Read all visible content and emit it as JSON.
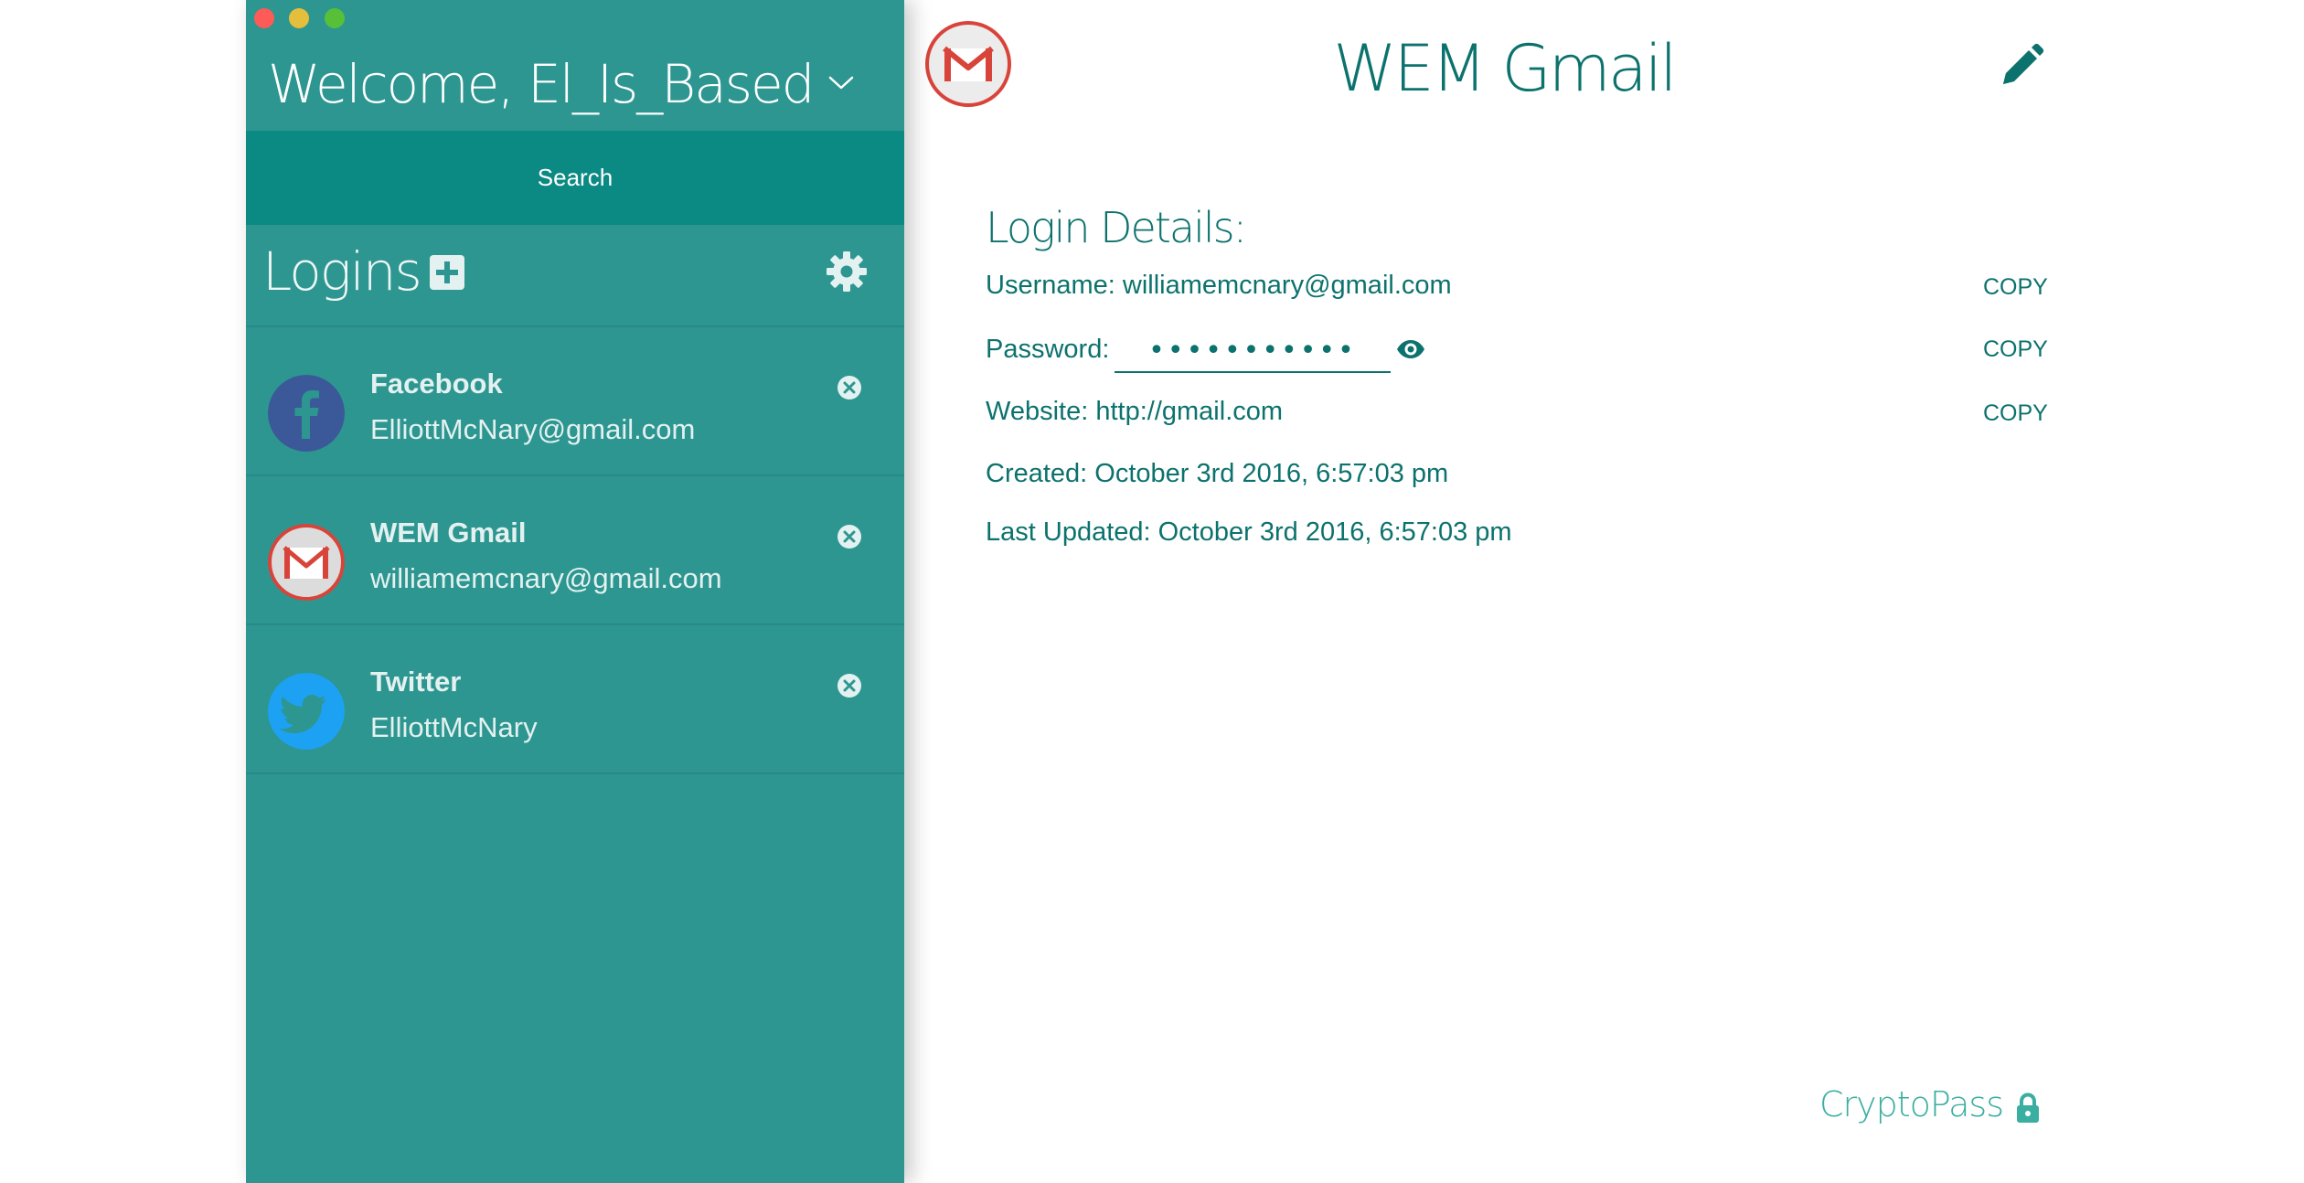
{
  "window": {
    "traffic_lights": [
      "close",
      "minimize",
      "zoom"
    ]
  },
  "sidebar": {
    "welcome": "Welcome, El_Is_Based",
    "search_label": "Search",
    "logins_title": "Logins",
    "items": [
      {
        "name": "Facebook",
        "sub": "ElliottMcNary@gmail.com",
        "icon": "facebook-icon"
      },
      {
        "name": "WEM Gmail",
        "sub": "williamemcnary@gmail.com",
        "icon": "gmail-icon"
      },
      {
        "name": "Twitter",
        "sub": "ElliottMcNary",
        "icon": "twitter-icon"
      }
    ]
  },
  "main": {
    "title": "WEM Gmail",
    "details_title": "Login Details:",
    "username": "Username: williamemcnary@gmail.com",
    "password_label": "Password:",
    "password_value": "•••••••••••",
    "website": "Website: http://gmail.com",
    "created": "Created: October 3rd 2016, 6:57:03 pm",
    "updated": "Last Updated: October 3rd 2016, 6:57:03 pm",
    "copy_label": "COPY"
  },
  "brand": "CryptoPass",
  "colors": {
    "sidebar": "#2d9690",
    "search_bar": "#0b8983",
    "accent_text": "#0c726d",
    "brand": "#3aaea0",
    "gmail_red": "#d9443a",
    "facebook_blue": "#3b5998",
    "twitter_blue": "#1da1f2"
  }
}
